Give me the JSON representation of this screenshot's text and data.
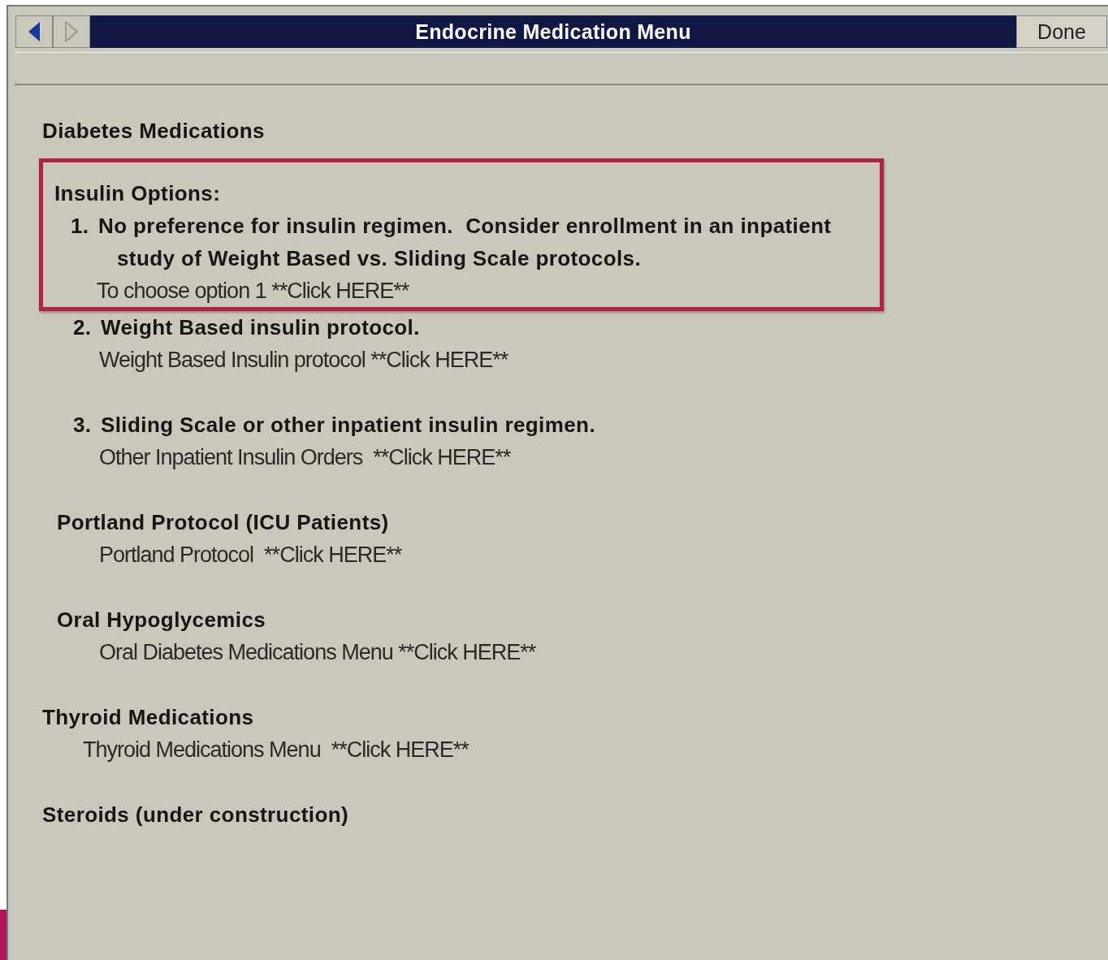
{
  "window": {
    "title": "Endocrine Medication Menu",
    "done_button": "Done"
  },
  "lines": [
    {
      "kind": "section",
      "text": "Diabetes Medications",
      "highlighted": false
    },
    {
      "kind": "group",
      "text": "Insulin Options:",
      "highlighted": true
    },
    {
      "kind": "option",
      "number": "1.",
      "text": "No preference for insulin regimen.  Consider enrollment in an inpatient study of Weight Based vs. Sliding Scale protocols.",
      "highlighted": true
    },
    {
      "kind": "link",
      "text": "To choose option 1 **Click HERE**",
      "highlighted": true
    },
    {
      "kind": "option",
      "number": "2.",
      "text": "Weight Based insulin protocol.",
      "highlighted": false
    },
    {
      "kind": "link",
      "text": "Weight Based Insulin protocol **Click HERE**",
      "highlighted": false
    },
    {
      "kind": "option",
      "number": "3.",
      "text": "Sliding Scale or other inpatient insulin regimen.",
      "highlighted": false
    },
    {
      "kind": "link",
      "text": "Other Inpatient Insulin Orders  **Click HERE**",
      "highlighted": false
    },
    {
      "kind": "group",
      "text": "Portland Protocol (ICU Patients)",
      "highlighted": false
    },
    {
      "kind": "link",
      "text": "Portland Protocol  **Click HERE**",
      "highlighted": false
    },
    {
      "kind": "group",
      "text": "Oral Hypoglycemics",
      "highlighted": false
    },
    {
      "kind": "link",
      "text": "Oral Diabetes Medications Menu **Click HERE**",
      "highlighted": false
    },
    {
      "kind": "section",
      "text": "Thyroid Medications",
      "highlighted": false
    },
    {
      "kind": "section-link",
      "text": "Thyroid Medications Menu  **Click HERE**",
      "highlighted": false
    },
    {
      "kind": "section",
      "text": "Steroids (under construction)",
      "highlighted": false
    }
  ]
}
